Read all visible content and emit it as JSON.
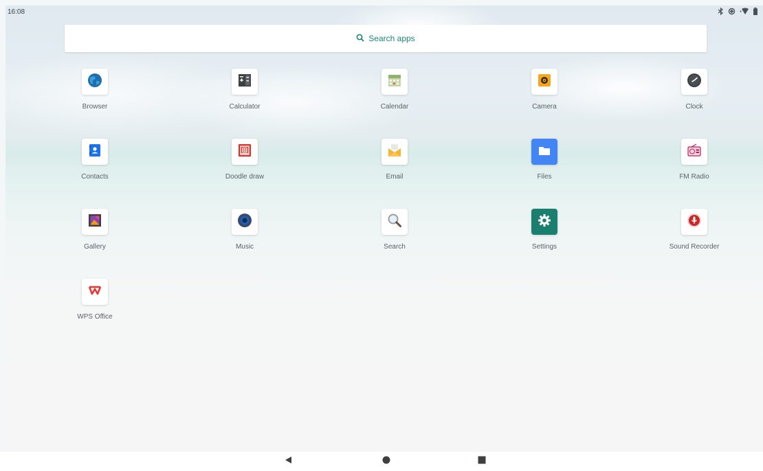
{
  "status_bar": {
    "time": "16:08",
    "icons": [
      "bluetooth-icon",
      "data-saver-icon",
      "wifi-icon",
      "battery-icon"
    ]
  },
  "search": {
    "label": "Search apps",
    "icon": "search-icon",
    "accent_color": "#1a8778"
  },
  "apps": [
    {
      "label": "Browser",
      "icon": "browser-globe-icon"
    },
    {
      "label": "Calculator",
      "icon": "calculator-icon"
    },
    {
      "label": "Calendar",
      "icon": "calendar-icon"
    },
    {
      "label": "Camera",
      "icon": "camera-icon"
    },
    {
      "label": "Clock",
      "icon": "clock-icon"
    },
    {
      "label": "Contacts",
      "icon": "contacts-icon"
    },
    {
      "label": "Doodle draw",
      "icon": "doodle-draw-icon"
    },
    {
      "label": "Email",
      "icon": "email-icon"
    },
    {
      "label": "Files",
      "icon": "files-folder-icon"
    },
    {
      "label": "FM Radio",
      "icon": "radio-icon"
    },
    {
      "label": "Gallery",
      "icon": "gallery-icon"
    },
    {
      "label": "Music",
      "icon": "music-speaker-icon"
    },
    {
      "label": "Search",
      "icon": "magnifier-icon"
    },
    {
      "label": "Settings",
      "icon": "settings-gear-icon"
    },
    {
      "label": "Sound Recorder",
      "icon": "microphone-icon"
    },
    {
      "label": "WPS Office",
      "icon": "wps-office-icon"
    }
  ],
  "nav_bar": {
    "buttons": [
      "back-icon",
      "home-icon",
      "recents-icon"
    ]
  }
}
